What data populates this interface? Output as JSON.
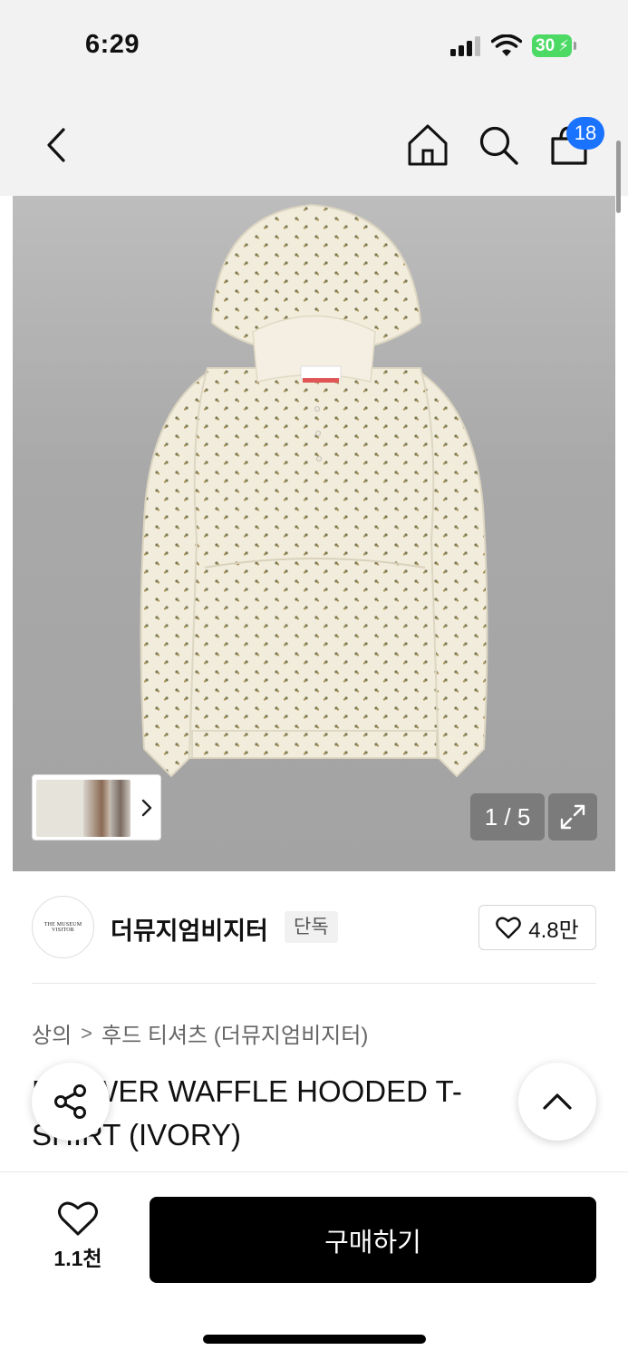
{
  "status_bar": {
    "time": "6:29",
    "battery_level": "30",
    "icons": [
      "cellular-signal-icon",
      "wifi-icon",
      "battery-charging-icon"
    ]
  },
  "nav": {
    "icons": [
      "chevron-left-icon",
      "home-icon",
      "search-icon",
      "shopping-bag-icon"
    ],
    "cart_badge": "18"
  },
  "gallery": {
    "page_counter": "1 / 5",
    "current_page": 1,
    "total_pages": 5,
    "icons": [
      "chevron-right-icon",
      "expand-icon"
    ]
  },
  "brand": {
    "logo_text": "THE MUSEUM VISITOR",
    "name": "더뮤지엄비지터",
    "exclusive_tag": "단독",
    "like_count": "4.8만"
  },
  "breadcrumb": {
    "category": "상의",
    "separator": ">",
    "subcategory": "후드 티셔츠 (더뮤지엄비지터)"
  },
  "product": {
    "title": "FLOWER WAFFLE HOODED T-SHIRT (IVORY)"
  },
  "bottom_bar": {
    "wish_count": "1.1천",
    "buy_label": "구매하기"
  },
  "colors": {
    "badge": "#1a73ff",
    "buy_button": "#000000",
    "image_background": "#a9a9a9",
    "hoodie_fabric": "#f1ecdc",
    "battery": "#4cd964"
  }
}
